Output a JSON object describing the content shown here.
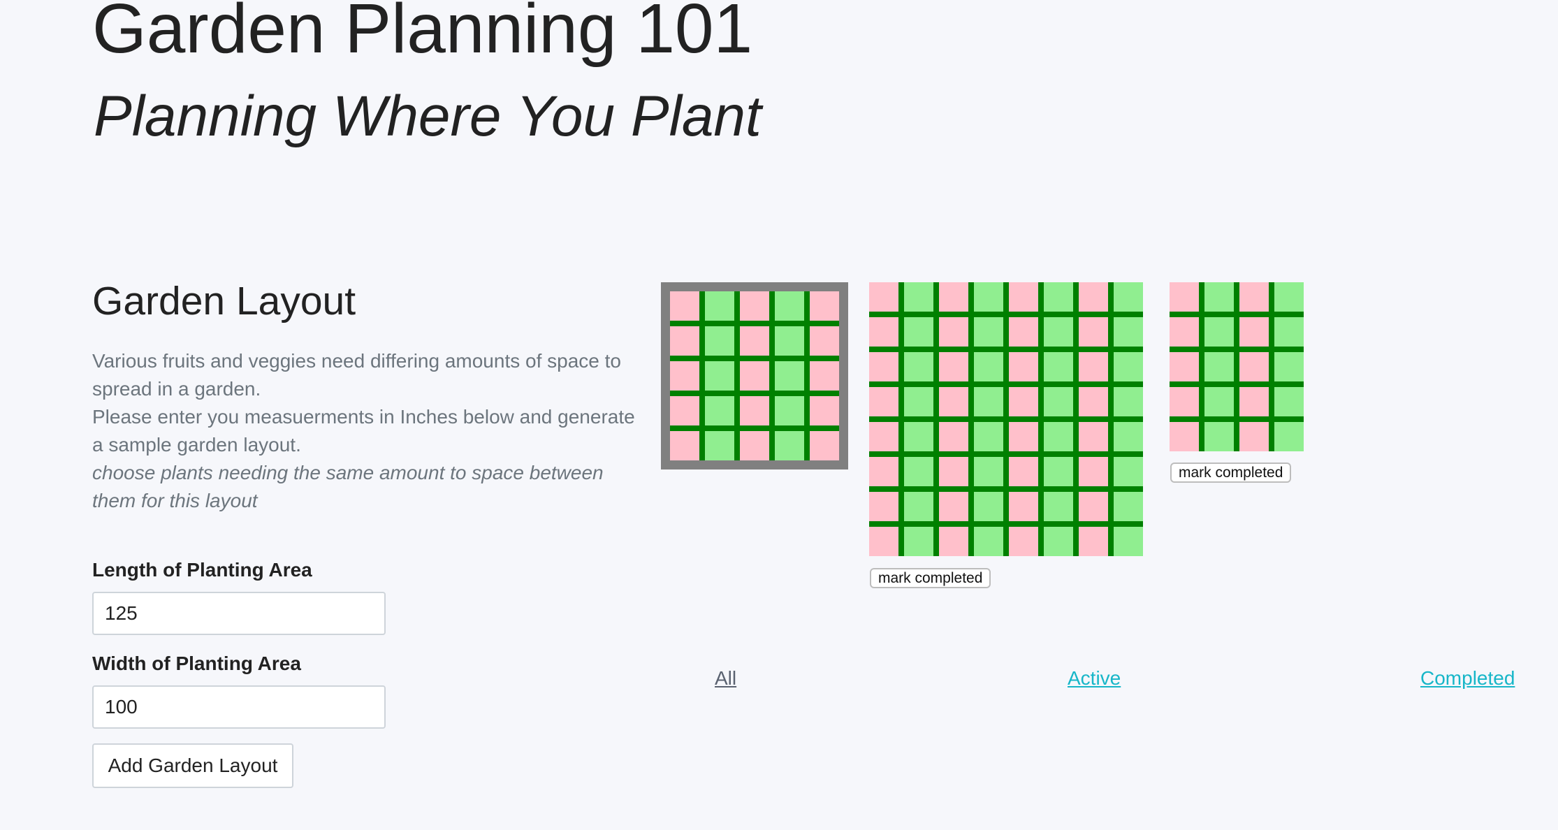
{
  "header": {
    "title": "Garden Planning 101",
    "subtitle": "Planning Where You Plant"
  },
  "layout_section": {
    "heading": "Garden Layout",
    "description_lines": [
      "Various fruits and veggies need differing amounts of space to spread in a garden.",
      "Please enter you measuerments in Inches below and generate a sample garden layout."
    ],
    "note": "choose plants needing the same amount to space between them for this layout"
  },
  "form": {
    "length_label": "Length of Planting Area",
    "length_value": "125",
    "width_label": "Width of Planting Area",
    "width_value": "100",
    "submit_label": "Add Garden Layout"
  },
  "colors": {
    "cell_pink": "#ffc0cb",
    "cell_green": "#90ee90",
    "grid_line": "#008000",
    "selected_border": "#808080",
    "filter_link": "#17b6c8"
  },
  "gardens": [
    {
      "columns": 5,
      "rows": 5,
      "selected": true
    },
    {
      "columns": 8,
      "rows": 8,
      "selected": false,
      "button_label": "mark completed"
    },
    {
      "columns": 4,
      "rows": 5,
      "selected": false,
      "button_label": "mark completed"
    }
  ],
  "filters": [
    {
      "label": "All",
      "active": false
    },
    {
      "label": "Active",
      "active": true
    },
    {
      "label": "Completed",
      "active": true
    }
  ]
}
